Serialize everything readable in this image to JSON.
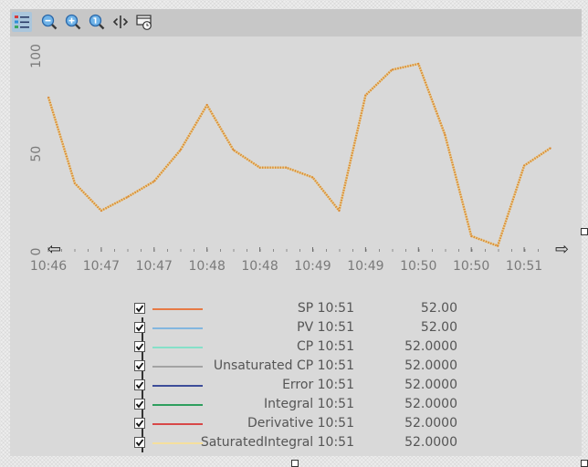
{
  "toolbar": {
    "buttons": [
      {
        "name": "legend-toggle-button",
        "icon": "list-color-icon",
        "active": true
      },
      {
        "name": "zoom-out-button",
        "icon": "zoom-out-icon"
      },
      {
        "name": "zoom-in-button",
        "icon": "zoom-in-icon"
      },
      {
        "name": "zoom-reset-button",
        "icon": "zoom-one-icon"
      },
      {
        "name": "pan-button",
        "icon": "horizontal-arrows-icon"
      },
      {
        "name": "time-range-button",
        "icon": "monitor-clock-icon"
      }
    ]
  },
  "chart_data": {
    "type": "line",
    "ylim": [
      0,
      110
    ],
    "y_ticks": [
      0,
      50,
      100
    ],
    "x_tick_labels": [
      "10:46",
      "10:47",
      "10:47",
      "10:48",
      "10:48",
      "10:49",
      "10:49",
      "10:50",
      "10:50",
      "10:51"
    ],
    "x_arrow_left": "⇦",
    "x_arrow_right": "⇨",
    "series": [
      {
        "values": [
          79,
          35,
          21,
          28,
          36,
          52,
          75,
          52,
          43,
          43,
          38,
          21,
          80,
          93,
          96,
          60,
          8,
          3,
          44,
          53
        ],
        "colors": [
          "#d98a3a",
          "#e8cf8e"
        ]
      }
    ]
  },
  "legend": {
    "rows": [
      {
        "checked": true,
        "color": "#e67a45",
        "label": "SP 10:51",
        "value": "52.00"
      },
      {
        "checked": true,
        "color": "#82b6df",
        "label": "PV 10:51",
        "value": "52.00"
      },
      {
        "checked": true,
        "color": "#86e0c8",
        "label": "CP 10:51",
        "value": "52.0000"
      },
      {
        "checked": true,
        "color": "#a3a3a3",
        "label": "Unsaturated CP 10:51",
        "value": "52.0000"
      },
      {
        "checked": true,
        "color": "#3d4d99",
        "label": "Error 10:51",
        "value": "52.0000"
      },
      {
        "checked": true,
        "color": "#2e9e5e",
        "label": "Integral 10:51",
        "value": "52.0000"
      },
      {
        "checked": true,
        "color": "#d84848",
        "label": "Derivative 10:51",
        "value": "52.0000"
      },
      {
        "checked": true,
        "color": "#f5df9d",
        "label": "SaturatedIntegral 10:51",
        "value": "52.0000"
      }
    ]
  }
}
